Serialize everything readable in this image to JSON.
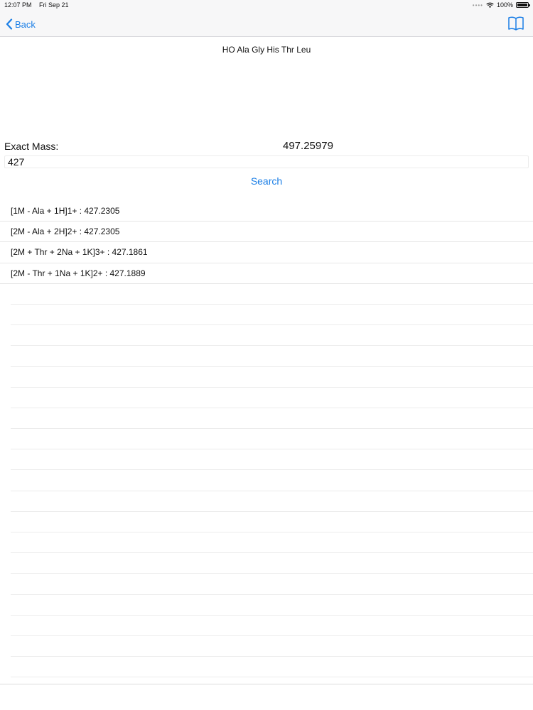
{
  "status_bar": {
    "time": "12:07 PM",
    "date": "Fri Sep 21",
    "battery": "100%"
  },
  "nav": {
    "back_label": "Back",
    "back_icon": "chevron-left-icon",
    "right_icon": "book-icon",
    "accent_color": "#1a7ee6"
  },
  "peptide": {
    "sequence": "HO Ala Gly His Thr Leu"
  },
  "mass": {
    "label": "Exact Mass:",
    "value": "497.25979"
  },
  "search": {
    "input_value": "427",
    "button_label": "Search"
  },
  "results": [
    "[1M - Ala + 1H]1+ : 427.2305",
    "[2M - Ala + 2H]2+ : 427.2305",
    "[2M + Thr + 2Na + 1K]3+ : 427.1861",
    "[2M - Thr + 1Na + 1K]2+ : 427.1889"
  ]
}
